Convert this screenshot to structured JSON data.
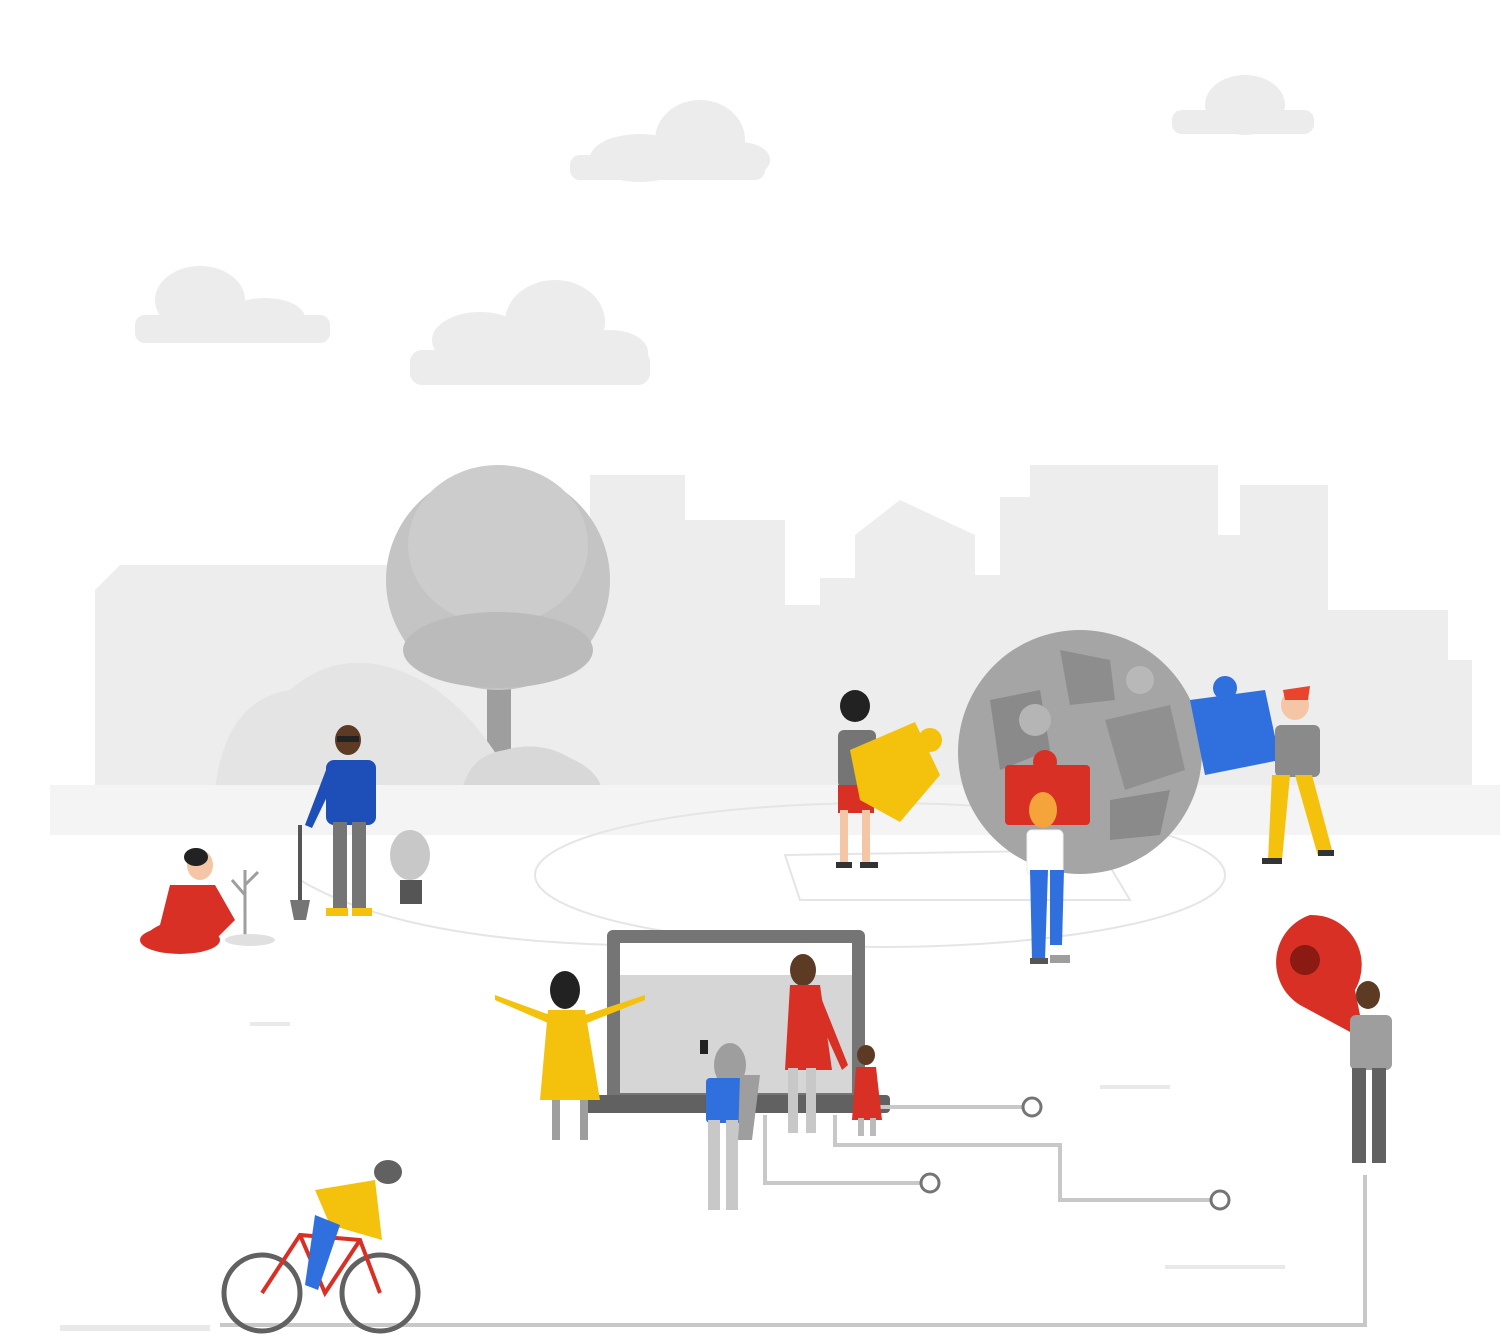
{
  "scene": {
    "palette": {
      "red": "#d93025",
      "yellow": "#f4c20d",
      "blue": "#2f6fde",
      "green": "#34a853",
      "light_gray": "#ececec",
      "mid_gray": "#c8c8c8",
      "dark_gray": "#757575",
      "skin_light": "#f5c6a5",
      "skin_dark": "#5d3a24",
      "hair": "#222222"
    },
    "icons": [
      "cloud-icon",
      "tree-icon",
      "city-skyline-icon",
      "globe-puzzle-icon",
      "puzzle-piece-icon",
      "laptop-icon",
      "map-pin-icon",
      "bicycle-icon",
      "potted-plant-icon",
      "shovel-icon",
      "circuit-line-icon"
    ]
  }
}
